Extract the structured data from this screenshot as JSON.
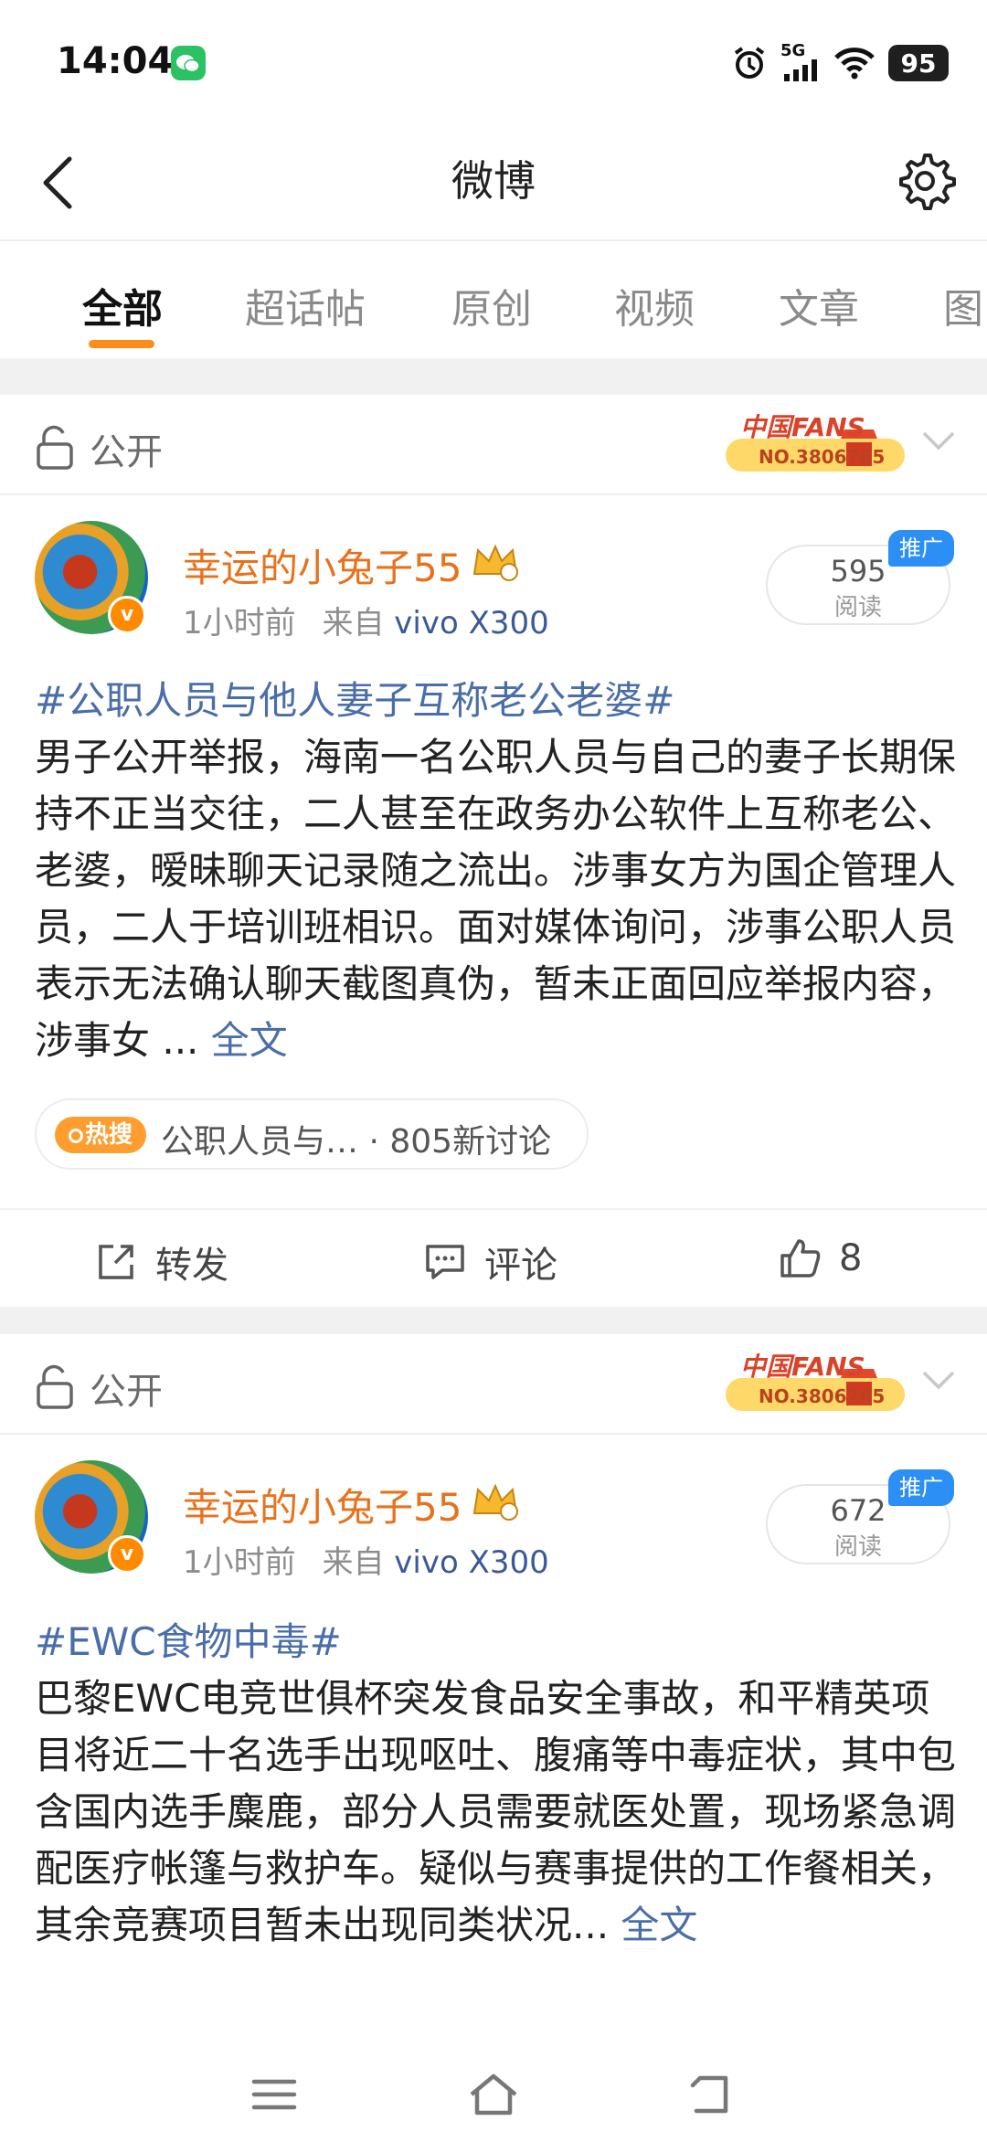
{
  "status": {
    "time": "14:04",
    "network": "5G",
    "battery": "95"
  },
  "nav": {
    "title": "微博"
  },
  "tabs": [
    {
      "label": "全部"
    },
    {
      "label": "超话帖"
    },
    {
      "label": "原创"
    },
    {
      "label": "视频"
    },
    {
      "label": "文章"
    },
    {
      "label": "图"
    }
  ],
  "posts": [
    {
      "visibility": "公开",
      "fans_badge": {
        "title": "中国FANS",
        "number": "NO.3806765"
      },
      "author": "幸运的小兔子55",
      "time": "1小时前",
      "source_prefix": "来自",
      "device": "vivo X300",
      "reads": "595",
      "reads_label": "阅读",
      "promo": "推广",
      "hashtag": "#公职人员与他人妻子互称老公老婆#",
      "body": "男子公开举报，海南一名公职人员与自己的妻子长期保持不正当交往，二人甚至在政务办公软件上互称老公、老婆，暧昧聊天记录随之流出。涉事女方为国企管理人员，二人于培训班相识。面对媒体询问，涉事公职人员表示无法确认聊天截图真伪，暂未正面回应举报内容，涉事女 ...",
      "full_text": "全文",
      "hot": {
        "badge": "热搜",
        "topic": "公职人员与…",
        "count": "· 805新讨论"
      },
      "actions": {
        "repost": "转发",
        "comment": "评论",
        "likes": "8"
      }
    },
    {
      "visibility": "公开",
      "fans_badge": {
        "title": "中国FANS",
        "number": "NO.3806765"
      },
      "author": "幸运的小兔子55",
      "time": "1小时前",
      "source_prefix": "来自",
      "device": "vivo X300",
      "reads": "672",
      "reads_label": "阅读",
      "promo": "推广",
      "hashtag": "#EWC食物中毒#",
      "body": "巴黎EWC电竞世俱杯突发食品安全事故，和平精英项目将近二十名选手出现呕吐、腹痛等中毒症状，其中包含国内选手麋鹿，部分人员需要就医处置，现场紧急调配医疗帐篷与救护车。疑似与赛事提供的工作餐相关，其余竞赛项目暂未出现同类状况...",
      "full_text": "全文"
    }
  ],
  "colors": {
    "accent": "#ff8c1a",
    "link": "#4a6ea9",
    "author": "#e8711c"
  }
}
